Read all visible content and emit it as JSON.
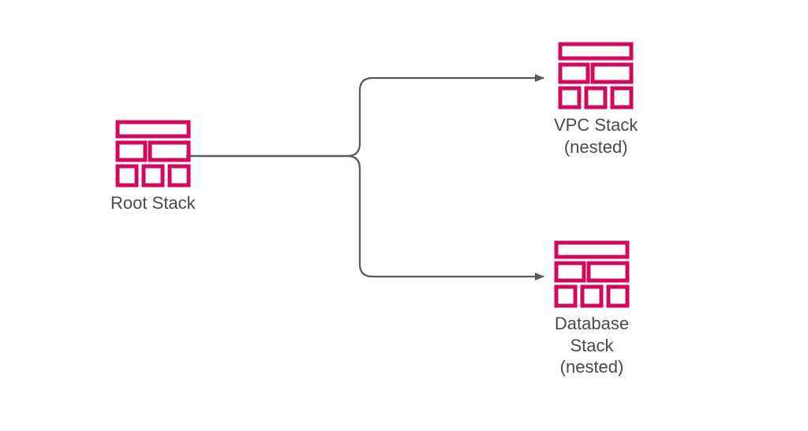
{
  "diagram": {
    "accent_color": "#cf0a5f",
    "line_color": "#595959",
    "nodes": {
      "root": {
        "label": "Root Stack"
      },
      "vpc": {
        "label": "VPC Stack\n(nested)"
      },
      "db": {
        "label": "Database\nStack\n(nested)"
      }
    }
  }
}
